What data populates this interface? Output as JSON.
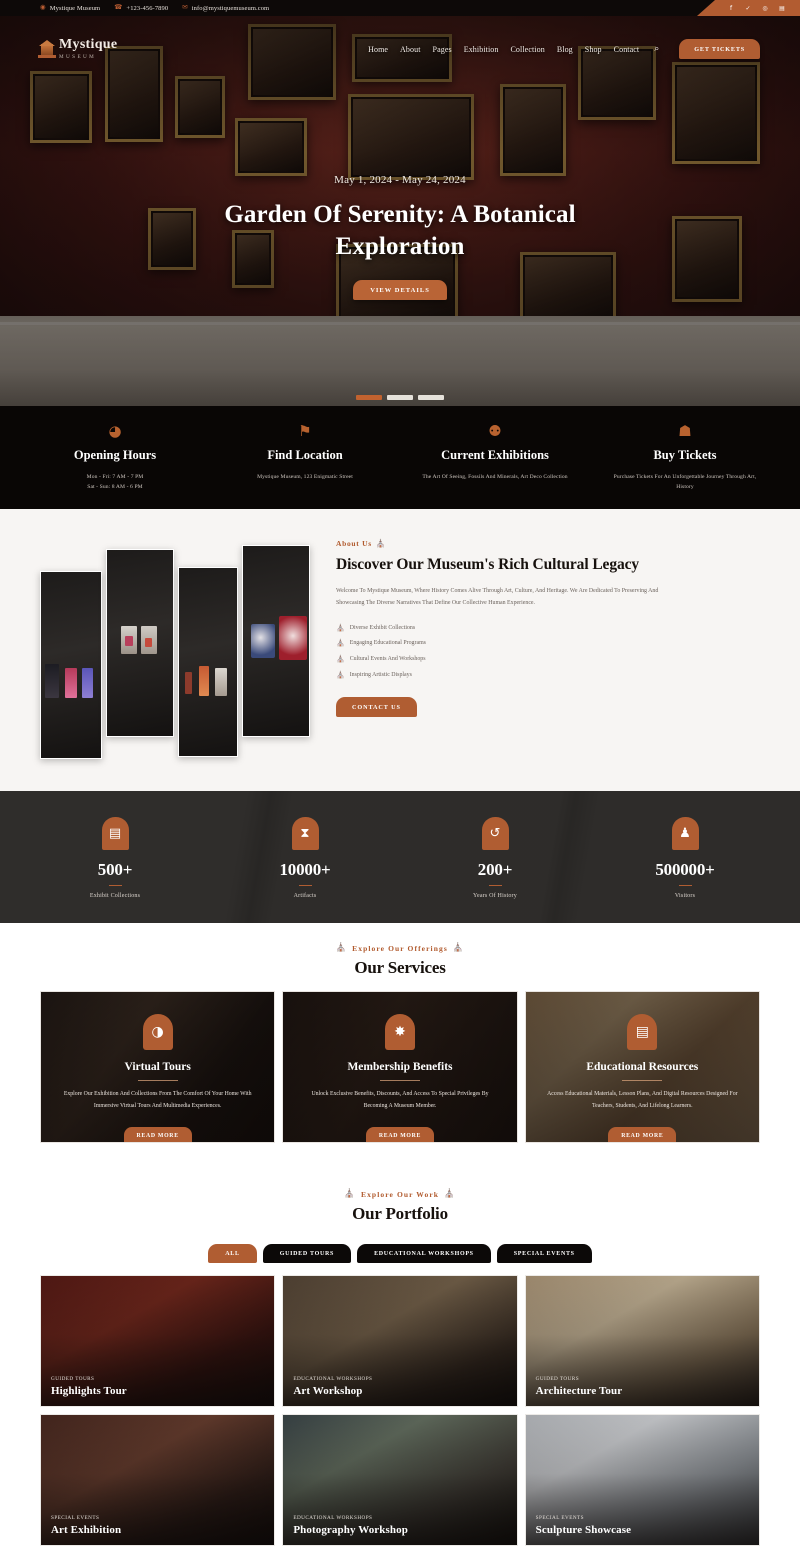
{
  "topbar": {
    "items": [
      {
        "icon": "location-pin-icon",
        "glyph": "◉",
        "text": "Mystique Museum"
      },
      {
        "icon": "phone-icon",
        "glyph": "☎",
        "text": "+123-456-7890"
      },
      {
        "icon": "envelope-icon",
        "glyph": "✉",
        "text": "info@mystiquemuseum.com"
      }
    ],
    "socials": [
      {
        "name": "facebook-icon",
        "glyph": "f"
      },
      {
        "name": "twitter-icon",
        "glyph": "✓"
      },
      {
        "name": "instagram-icon",
        "glyph": "◎"
      },
      {
        "name": "linkedin-icon",
        "glyph": "▤"
      }
    ]
  },
  "header": {
    "logo_name": "Mystique",
    "logo_sub": "MUSEUM",
    "menu": [
      "Home",
      "About",
      "Pages",
      "Exhibition",
      "Collection",
      "Blog",
      "Shop",
      "Contact"
    ],
    "search_glyph": "⌕",
    "cta": "GET TICKETS"
  },
  "hero": {
    "date": "May 1, 2024 - May 24, 2024",
    "title": "Garden Of Serenity: A Botanical Exploration",
    "button": "VIEW DETAILS",
    "slides": 3,
    "active_slide": 1
  },
  "infobar": [
    {
      "icon": "clock-icon",
      "glyph": "◕",
      "title": "Opening Hours",
      "lines": [
        "Mon - Fri: 7 AM - 7 PM",
        "Sat - Sun: 8 AM - 6 PM"
      ]
    },
    {
      "icon": "map-marker-icon",
      "glyph": "⚑",
      "title": "Find Location",
      "lines": [
        "Mystique Museum, 123 Enigmatic Street"
      ]
    },
    {
      "icon": "binoculars-icon",
      "glyph": "⚉",
      "title": "Current Exhibitions",
      "lines": [
        "The Art Of Seeing, Fossils And Minerals, Art Deco Collection"
      ]
    },
    {
      "icon": "ticket-icon",
      "glyph": "☗",
      "title": "Buy Tickets",
      "lines": [
        "Purchase Tickets For An Unforgettable Journey Through Art,",
        "History"
      ]
    }
  ],
  "about": {
    "eyebrow": "About Us",
    "eyebrow_icon_glyph": "⛪",
    "heading": "Discover Our Museum's Rich Cultural Legacy",
    "paragraph": "Welcome To Mystique Museum, Where History Comes Alive Through Art, Culture, And Heritage. We Are Dedicated To Preserving And Showcasing The Diverse Narratives That Define Our Collective Human Experience.",
    "bullets": [
      "Diverse Exhibit Collections",
      "Engaging Educational Programs",
      "Cultural Events And Workshops",
      "Inspiring Artistic Displays"
    ],
    "bullet_icon_glyph": "⛪",
    "button": "CONTACT US"
  },
  "stats": [
    {
      "icon": "book-icon",
      "glyph": "▤",
      "number": "500+",
      "label": "Exhibit Collections"
    },
    {
      "icon": "hourglass-icon",
      "glyph": "⧗",
      "number": "10000+",
      "label": "Artifacts"
    },
    {
      "icon": "history-icon",
      "glyph": "↺",
      "number": "200+",
      "label": "Years Of History"
    },
    {
      "icon": "people-icon",
      "glyph": "♟",
      "number": "500000+",
      "label": "Visitors"
    }
  ],
  "services": {
    "eyebrow": "Explore Our Offerings",
    "eyebrow_icon_glyph": "⛪",
    "title": "Our Services",
    "read_more": "READ MORE",
    "cards": [
      {
        "icon": "vr-headset-icon",
        "glyph": "◑",
        "title": "Virtual Tours",
        "text": "Explore Our Exhibition And Collections From The Comfort Of Your Home With Immersive Virtual Tours And Multimedia Experiences."
      },
      {
        "icon": "badge-star-icon",
        "glyph": "✸",
        "title": "Membership Benefits",
        "text": "Unlock Exclusive Benefits, Discounts, And Access To Special Privileges By Becoming A Museum Member."
      },
      {
        "icon": "book-open-icon",
        "glyph": "▤",
        "title": "Educational Resources",
        "text": "Access Educational Materials, Lesson Plans, And Digital Resources Designed For Teachers, Students, And Lifelong Learners."
      }
    ]
  },
  "portfolio": {
    "eyebrow": "Explore Our Work",
    "eyebrow_icon_glyph": "⛪",
    "title": "Our Portfolio",
    "filters": [
      "ALL",
      "GUIDED TOURS",
      "EDUCATIONAL WORKSHOPS",
      "SPECIAL EVENTS"
    ],
    "active_filter": "ALL",
    "items": [
      {
        "category": "GUIDED TOURS",
        "name": "Highlights Tour"
      },
      {
        "category": "EDUCATIONAL WORKSHOPS",
        "name": "Art Workshop"
      },
      {
        "category": "GUIDED TOURS",
        "name": "Architecture Tour"
      },
      {
        "category": "SPECIAL EVENTS",
        "name": "Art Exhibition"
      },
      {
        "category": "EDUCATIONAL WORKSHOPS",
        "name": "Photography Workshop"
      },
      {
        "category": "SPECIAL EVENTS",
        "name": "Sculpture Showcase"
      }
    ]
  },
  "colors": {
    "accent": "#b05d32",
    "dark": "#0c0908",
    "stats_bg": "#2c2a28",
    "about_bg": "#f7f5f3"
  }
}
